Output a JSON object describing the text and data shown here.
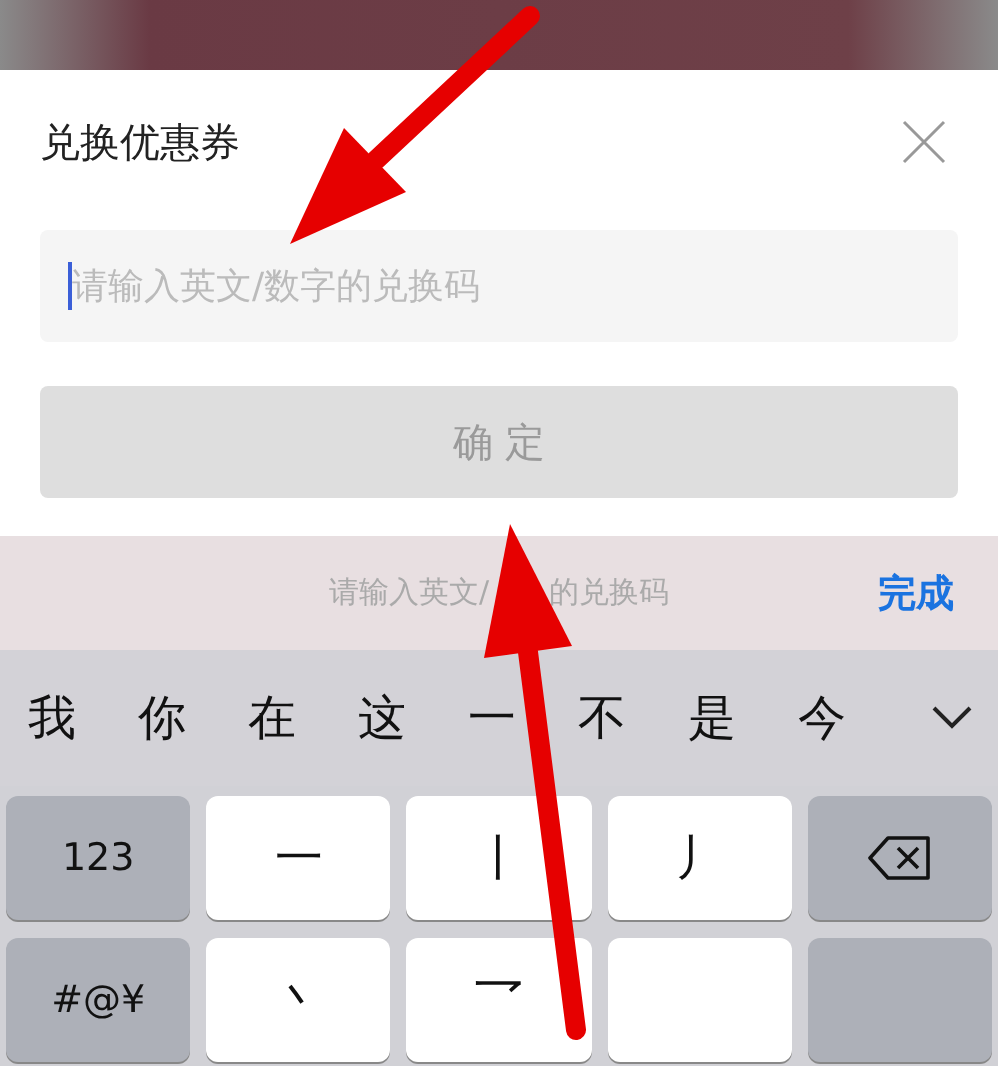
{
  "dialog": {
    "title": "兑换优惠券",
    "field": {
      "placeholder": "请输入英文/数字的兑换码",
      "focused": true
    },
    "confirm_button": {
      "label": "确 定",
      "disabled": true
    }
  },
  "keyboard_toolbar": {
    "hint_parts": [
      "请输入英文/",
      "的兑换码"
    ],
    "done": "完成"
  },
  "candidates": [
    "我",
    "你",
    "在",
    "这",
    "一",
    "不",
    "是",
    "今"
  ],
  "key_rows": [
    [
      {
        "kind": "function",
        "label": "123"
      },
      {
        "kind": "stroke",
        "label": "一"
      },
      {
        "kind": "stroke",
        "label": "丨"
      },
      {
        "kind": "stroke",
        "label": "丿"
      },
      {
        "kind": "delete"
      }
    ],
    [
      {
        "kind": "function",
        "label": "#@¥"
      },
      {
        "kind": "stroke",
        "label": "丶"
      },
      {
        "kind": "stroke",
        "label": "乛"
      },
      {
        "kind": "stroke"
      },
      {
        "kind": "function"
      }
    ]
  ]
}
